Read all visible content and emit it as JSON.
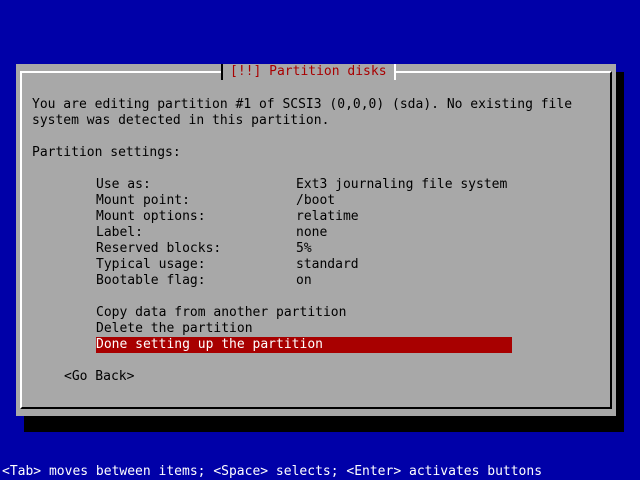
{
  "dialog": {
    "title": "[!!] Partition disks",
    "intro_line1": "You are editing partition #1 of SCSI3 (0,0,0) (sda). No existing file",
    "intro_line2": "system was detected in this partition.",
    "settings_header": "Partition settings:",
    "settings": [
      {
        "label": "Use as:",
        "value": "Ext3 journaling file system"
      },
      {
        "label": "Mount point:",
        "value": "/boot"
      },
      {
        "label": "Mount options:",
        "value": "relatime"
      },
      {
        "label": "Label:",
        "value": "none"
      },
      {
        "label": "Reserved blocks:",
        "value": "5%"
      },
      {
        "label": "Typical usage:",
        "value": "standard"
      },
      {
        "label": "Bootable flag:",
        "value": "on"
      }
    ],
    "actions": [
      {
        "label": "Copy data from another partition"
      },
      {
        "label": "Delete the partition"
      },
      {
        "label": "Done setting up the partition"
      }
    ],
    "go_back": "<Go Back>"
  },
  "status_bar": "<Tab> moves between items; <Space> selects; <Enter> activates buttons",
  "colors": {
    "background": "#0000a8",
    "dialog": "#a8a8a8",
    "title": "#a80000",
    "selection": "#a80000"
  }
}
